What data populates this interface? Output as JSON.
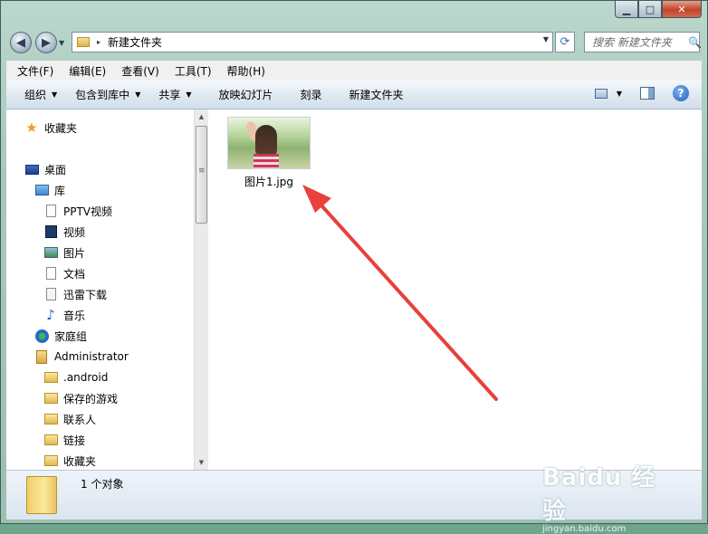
{
  "window": {
    "caption_buttons": {
      "minimize": "▁",
      "maximize": "□",
      "close": "✕"
    }
  },
  "address_bar": {
    "path": "新建文件夹",
    "separator": "▸",
    "back": "◀",
    "forward": "▶",
    "dropdown": "▼",
    "refresh": "⟳"
  },
  "search": {
    "placeholder": "搜索 新建文件夹",
    "icon": "search-icon",
    "glyph": "🔍"
  },
  "menu": [
    "文件(F)",
    "编辑(E)",
    "查看(V)",
    "工具(T)",
    "帮助(H)"
  ],
  "commands": [
    {
      "label": "组织",
      "dropdown": true
    },
    {
      "label": "包含到库中",
      "dropdown": true
    },
    {
      "label": "共享",
      "dropdown": true
    },
    {
      "label": "放映幻灯片",
      "dropdown": false
    },
    {
      "label": "刻录",
      "dropdown": false
    },
    {
      "label": "新建文件夹",
      "dropdown": false
    }
  ],
  "help_label": "?",
  "nav": [
    {
      "label": "收藏夹",
      "icon": "star-icon"
    },
    {
      "label": "桌面",
      "icon": "desktop-icon"
    },
    {
      "label": "库",
      "icon": "library-icon"
    },
    {
      "label": "PPTV视频",
      "icon": "document-icon"
    },
    {
      "label": "视频",
      "icon": "video-icon"
    },
    {
      "label": "图片",
      "icon": "pictures-icon"
    },
    {
      "label": "文档",
      "icon": "document-icon"
    },
    {
      "label": "迅雷下载",
      "icon": "download-icon"
    },
    {
      "label": "音乐",
      "icon": "music-icon"
    },
    {
      "label": "家庭组",
      "icon": "homegroup-icon"
    },
    {
      "label": "Administrator",
      "icon": "user-folder-icon"
    },
    {
      "label": ".android",
      "icon": "folder-icon"
    },
    {
      "label": "保存的游戏",
      "icon": "folder-icon"
    },
    {
      "label": "联系人",
      "icon": "folder-icon"
    },
    {
      "label": "链接",
      "icon": "folder-icon"
    },
    {
      "label": "收藏夹",
      "icon": "folder-icon"
    }
  ],
  "files": [
    {
      "name": "图片1.jpg",
      "type": "image-thumbnail"
    }
  ],
  "status": {
    "count": "1 个对象"
  },
  "watermark": {
    "logo": "Baidu 经验",
    "url": "jingyan.baidu.com"
  },
  "colors": {
    "arrow": "#e8403c",
    "command_bar": "#dfe8f1"
  }
}
